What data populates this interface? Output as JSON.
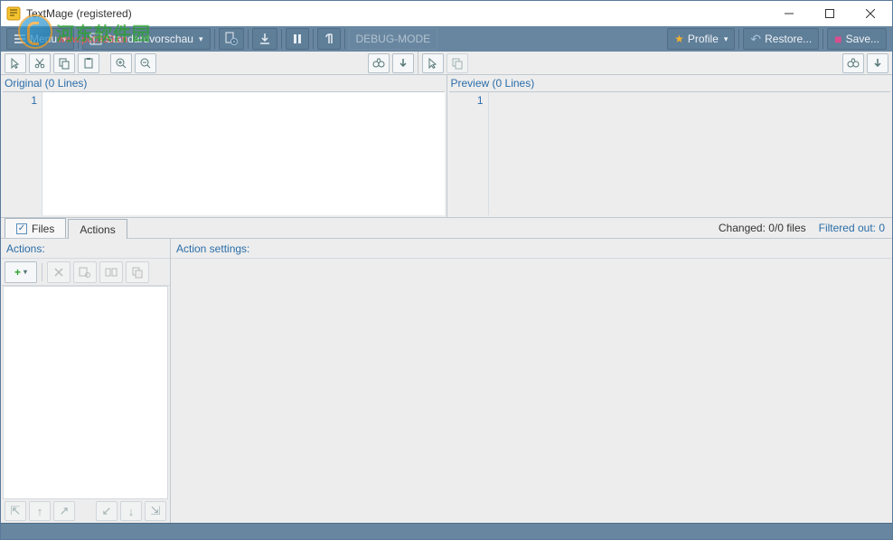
{
  "window": {
    "title": "TextMage (registered)"
  },
  "watermark": {
    "text": "河东软件园",
    "sub": "www.pc0359.cn"
  },
  "toolbar": {
    "menu_label": "Menu",
    "preview_mode_label": "Standardvorschau",
    "debug_label": "DEBUG-MODE",
    "profile_label": "Profile",
    "restore_label": "Restore...",
    "save_label": "Save..."
  },
  "editors": {
    "original_header": "Original (0 Lines)",
    "preview_header": "Preview (0 Lines)",
    "line_number": "1"
  },
  "tabs": {
    "files_label": "Files",
    "actions_label": "Actions",
    "changed_label": "Changed: 0/0 files",
    "filtered_label": "Filtered out: 0"
  },
  "panels": {
    "actions_header": "Actions:",
    "settings_header": "Action settings:"
  }
}
